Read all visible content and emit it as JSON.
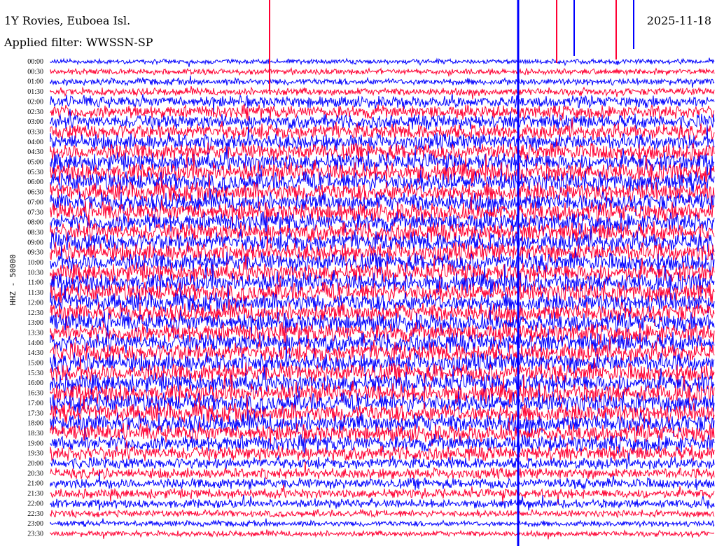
{
  "header": {
    "station": "1Y Rovies, Euboea Isl.",
    "filter": "Applied filter: WWSSN-SP",
    "date": "2025-11-18"
  },
  "chart_data": {
    "type": "line",
    "title": "1Y Rovies, Euboea Isl.",
    "subtitle": "Applied filter: WWSSN-SP",
    "date": "2025-11-18",
    "ylabel": "HHZ - 50000",
    "row_labels": [
      "00:00",
      "00:30",
      "01:00",
      "01:30",
      "02:00",
      "02:30",
      "03:00",
      "03:30",
      "04:00",
      "04:30",
      "05:00",
      "05:30",
      "06:00",
      "06:30",
      "07:00",
      "07:30",
      "08:00",
      "08:30",
      "09:00",
      "09:30",
      "10:00",
      "10:30",
      "11:00",
      "11:30",
      "12:00",
      "12:30",
      "13:00",
      "13:30",
      "14:00",
      "14:30",
      "15:00",
      "15:30",
      "16:00",
      "16:30",
      "17:00",
      "17:30",
      "18:00",
      "18:30",
      "19:00",
      "19:30",
      "20:00",
      "20:30",
      "21:00",
      "21:30",
      "22:00",
      "22:30",
      "23:00",
      "23:30"
    ],
    "series_colors": [
      "#0000ff",
      "#ff0033"
    ],
    "relative_amplitude_by_row": [
      0.25,
      0.3,
      0.35,
      0.4,
      0.6,
      0.7,
      0.75,
      0.8,
      0.85,
      0.9,
      0.95,
      1.0,
      1.0,
      1.0,
      1.0,
      1.0,
      1.0,
      1.0,
      1.0,
      1.0,
      1.0,
      1.0,
      1.0,
      1.0,
      1.0,
      1.0,
      1.0,
      1.0,
      1.0,
      1.0,
      1.0,
      1.0,
      1.0,
      1.0,
      1.0,
      1.0,
      1.0,
      0.9,
      0.85,
      0.75,
      0.6,
      0.55,
      0.55,
      0.5,
      0.45,
      0.35,
      0.3,
      0.3
    ]
  }
}
